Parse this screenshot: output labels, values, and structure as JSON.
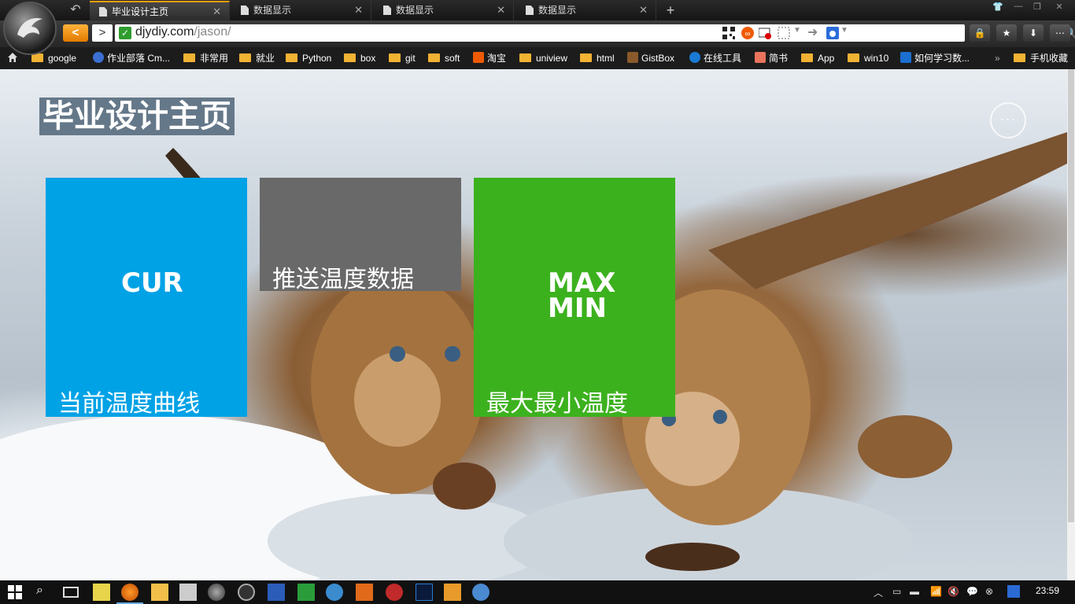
{
  "browser": {
    "tabs": [
      {
        "label": "毕业设计主页",
        "active": true
      },
      {
        "label": "数据显示",
        "active": false
      },
      {
        "label": "数据显示",
        "active": false
      },
      {
        "label": "数据显示",
        "active": false
      }
    ],
    "url": {
      "host": "djydiy.com",
      "path": "/jason/"
    },
    "bookmarks": [
      {
        "label": "google",
        "icon": "folder-icon"
      },
      {
        "label": "作业部落 Cm...",
        "icon": "site-icon"
      },
      {
        "label": "非常用",
        "icon": "folder-icon"
      },
      {
        "label": "就业",
        "icon": "folder-icon"
      },
      {
        "label": "Python",
        "icon": "folder-icon"
      },
      {
        "label": "box",
        "icon": "folder-icon"
      },
      {
        "label": "git",
        "icon": "folder-icon"
      },
      {
        "label": "soft",
        "icon": "folder-icon"
      },
      {
        "label": "淘宝",
        "icon": "site-icon"
      },
      {
        "label": "uniview",
        "icon": "folder-icon"
      },
      {
        "label": "html",
        "icon": "folder-icon"
      },
      {
        "label": "GistBox",
        "icon": "site-icon"
      },
      {
        "label": "在线工具",
        "icon": "site-icon"
      },
      {
        "label": "简书",
        "icon": "site-icon"
      },
      {
        "label": "App",
        "icon": "folder-icon"
      },
      {
        "label": "win10",
        "icon": "folder-icon"
      },
      {
        "label": "如何学习数...",
        "icon": "site-icon"
      }
    ],
    "bookmarks_overflow": "»",
    "mobile_bookmarks": "手机收藏"
  },
  "page": {
    "title": "毕业设计主页",
    "more_label": "···",
    "tiles": {
      "cur": {
        "big": "CUR",
        "caption": "当前温度曲线",
        "color": "#00a2e6"
      },
      "push": {
        "caption": "推送温度数据",
        "color": "#696969"
      },
      "maxmin": {
        "big_line1": "MAX",
        "big_line2": "MIN",
        "caption": "最大最小温度",
        "color": "#3cb11e"
      }
    }
  },
  "taskbar": {
    "clock": "23:59",
    "accent": "#6aa8e0"
  }
}
